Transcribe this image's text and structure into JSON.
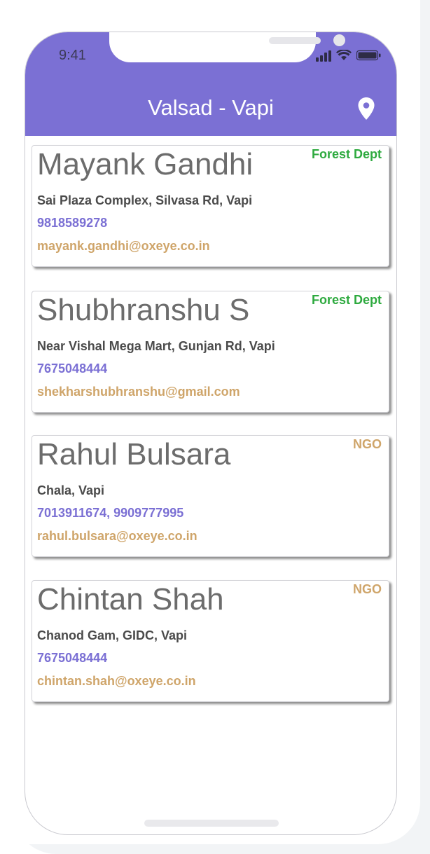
{
  "status_bar": {
    "time": "9:41"
  },
  "header": {
    "title": "Valsad - Vapi",
    "location_icon": "map-pin-icon",
    "bg_color": "#7b70d4"
  },
  "contacts": [
    {
      "name": "Mayank Gandhi",
      "tag": "Forest Dept",
      "tag_color": "#2eaa3f",
      "address": "Sai Plaza Complex, Silvasa Rd, Vapi",
      "phone": "9818589278",
      "email": "mayank.gandhi@oxeye.co.in"
    },
    {
      "name": "Shubhranshu S",
      "tag": "Forest Dept",
      "tag_color": "#2eaa3f",
      "address": "Near Vishal Mega Mart, Gunjan Rd, Vapi",
      "phone": "7675048444",
      "email": "shekharshubhranshu@gmail.com"
    },
    {
      "name": "Rahul Bulsara",
      "tag": "NGO",
      "tag_color": "#cfa56a",
      "address": "Chala, Vapi",
      "phone": "7013911674, 9909777995",
      "email": "rahul.bulsara@oxeye.co.in"
    },
    {
      "name": "Chintan Shah",
      "tag": "NGO",
      "tag_color": "#cfa56a",
      "address": "Chanod Gam, GIDC, Vapi",
      "phone": "7675048444",
      "email": "chintan.shah@oxeye.co.in"
    }
  ],
  "colors": {
    "phone": "#7b70d4",
    "email": "#cfa56a",
    "address": "#4b4b4b",
    "name": "#6c6c6c"
  }
}
